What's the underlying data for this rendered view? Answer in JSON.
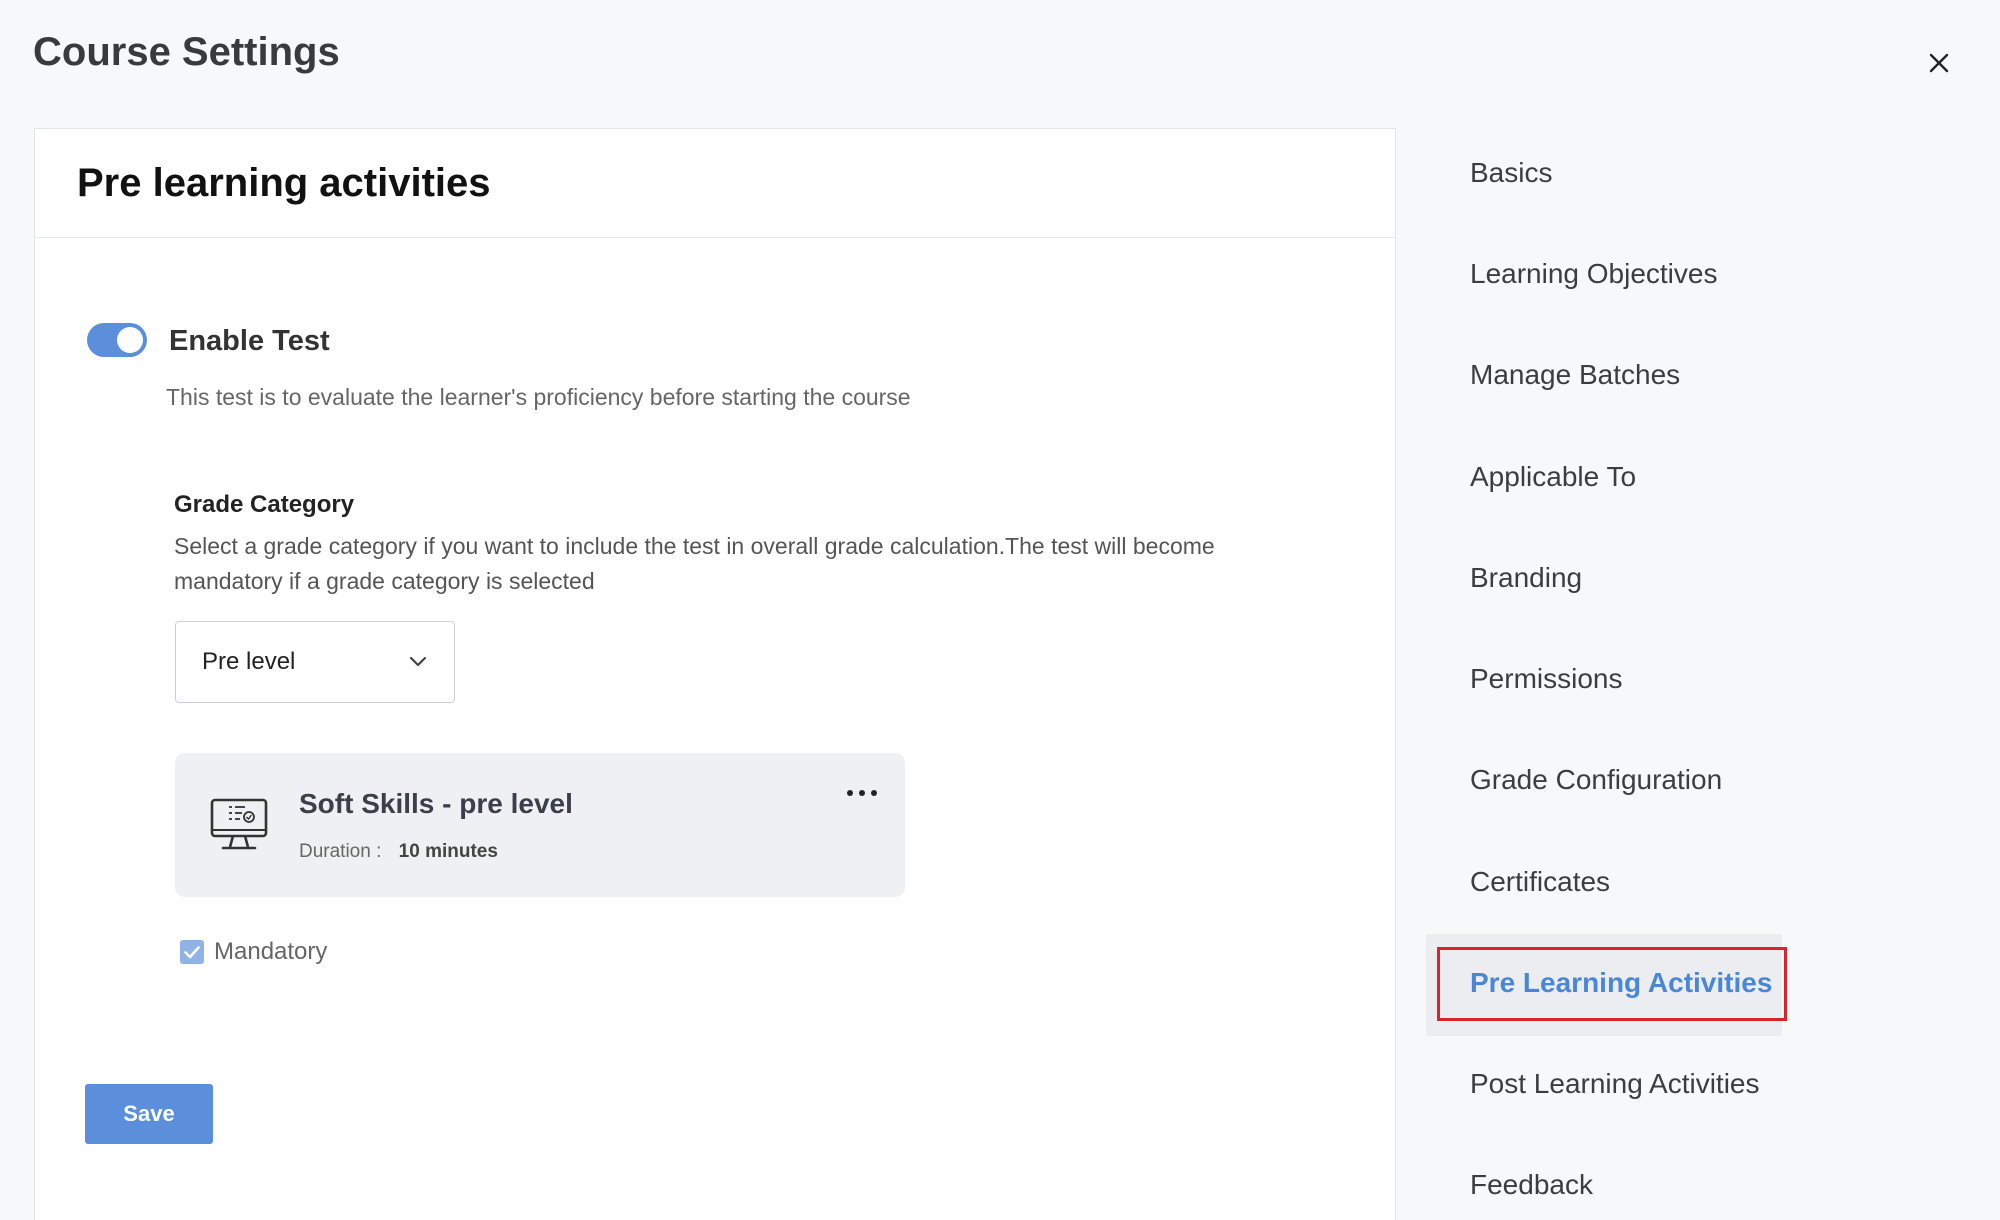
{
  "header": {
    "title": "Course Settings"
  },
  "card": {
    "title": "Pre learning activities"
  },
  "enable_test": {
    "label": "Enable Test",
    "enabled": true,
    "description": "This test is to evaluate the learner's proficiency before starting the course"
  },
  "grade_category": {
    "heading": "Grade Category",
    "description": "Select a grade category if you want to include the test in overall grade calculation.The test will become mandatory if a grade category is selected",
    "selected": "Pre level"
  },
  "test": {
    "name": "Soft Skills - pre level",
    "duration_label": "Duration :",
    "duration_value": "10 minutes",
    "icon": "monitor-test-icon"
  },
  "mandatory": {
    "label": "Mandatory",
    "checked": true
  },
  "actions": {
    "save_label": "Save"
  },
  "sidebar": {
    "items": [
      {
        "label": "Basics",
        "active": false
      },
      {
        "label": "Learning Objectives",
        "active": false
      },
      {
        "label": "Manage Batches",
        "active": false
      },
      {
        "label": "Applicable To",
        "active": false
      },
      {
        "label": "Branding",
        "active": false
      },
      {
        "label": "Permissions",
        "active": false
      },
      {
        "label": "Grade Configuration",
        "active": false
      },
      {
        "label": "Certificates",
        "active": false
      },
      {
        "label": "Pre Learning Activities",
        "active": true
      },
      {
        "label": "Post Learning Activities",
        "active": false
      },
      {
        "label": "Feedback",
        "active": false
      }
    ]
  },
  "colors": {
    "accent": "#5b8fdb",
    "active_nav_text": "#4a86d6",
    "highlight_border": "#d9252a"
  }
}
